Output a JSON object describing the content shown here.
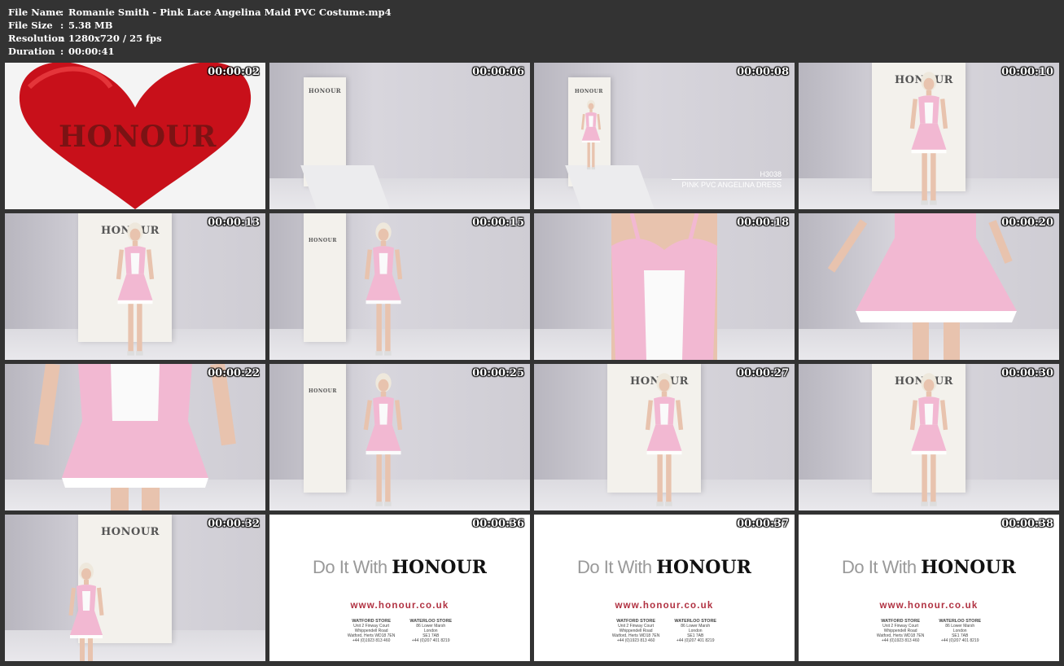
{
  "info": {
    "file_name_key": "File Name",
    "file_name_val": "Romanie Smith - Pink Lace Angelina Maid PVC Costume.mp4",
    "file_size_key": "File Size",
    "file_size_val": "5.38 MB",
    "resolution_key": "Resolution",
    "resolution_val": "1280x720 / 25 fps",
    "duration_key": "Duration",
    "duration_val": "00:00:41",
    "sep": ":"
  },
  "thumbs": [
    {
      "time": "00:00:02",
      "scene": "heart",
      "brand": "HONOUR"
    },
    {
      "time": "00:00:06",
      "scene": "empty-room",
      "brand": "HONOUR"
    },
    {
      "time": "00:00:08",
      "scene": "room-far",
      "brand": "HONOUR",
      "caption_code": "H3038",
      "caption_name": "PINK PVC ANGELINA DRESS"
    },
    {
      "time": "00:00:10",
      "scene": "model-front",
      "brand": "HONOUR"
    },
    {
      "time": "00:00:13",
      "scene": "model-front",
      "brand": "HONOUR"
    },
    {
      "time": "00:00:15",
      "scene": "model-side",
      "brand": "HONOUR"
    },
    {
      "time": "00:00:18",
      "scene": "closeup-bodice"
    },
    {
      "time": "00:00:20",
      "scene": "closeup-skirt"
    },
    {
      "time": "00:00:22",
      "scene": "closeup-waist"
    },
    {
      "time": "00:00:25",
      "scene": "model-back",
      "brand": "HONOUR"
    },
    {
      "time": "00:00:27",
      "scene": "model-mid",
      "brand": "HONOUR"
    },
    {
      "time": "00:00:30",
      "scene": "model-front",
      "brand": "HONOUR"
    },
    {
      "time": "00:00:32",
      "scene": "model-exit",
      "brand": "HONOUR"
    },
    {
      "time": "00:00:36",
      "scene": "endcard"
    },
    {
      "time": "00:00:37",
      "scene": "endcard"
    },
    {
      "time": "00:00:38",
      "scene": "endcard"
    }
  ],
  "endcard": {
    "tagline": "Do It With",
    "brand": "HONOUR",
    "url": "www.honour.co.uk",
    "store1_title": "WATFORD STORE",
    "store1_l1": "Unit 2 Finway Court",
    "store1_l2": "Whippendell Road",
    "store1_l3": "Watford, Herts WD18 7EN",
    "store1_phone": "+44 (0)1923 813 460",
    "store2_title": "WATERLOO STORE",
    "store2_l1": "86 Lower Marsh",
    "store2_l2": "London",
    "store2_l3": "SE1 7AB",
    "store2_phone": "+44 (0)207 401 8219"
  },
  "colors": {
    "background": "#333333",
    "heart": "#c8101a",
    "pvc_pink": "#f2b8d2",
    "url_red": "#b03040"
  }
}
